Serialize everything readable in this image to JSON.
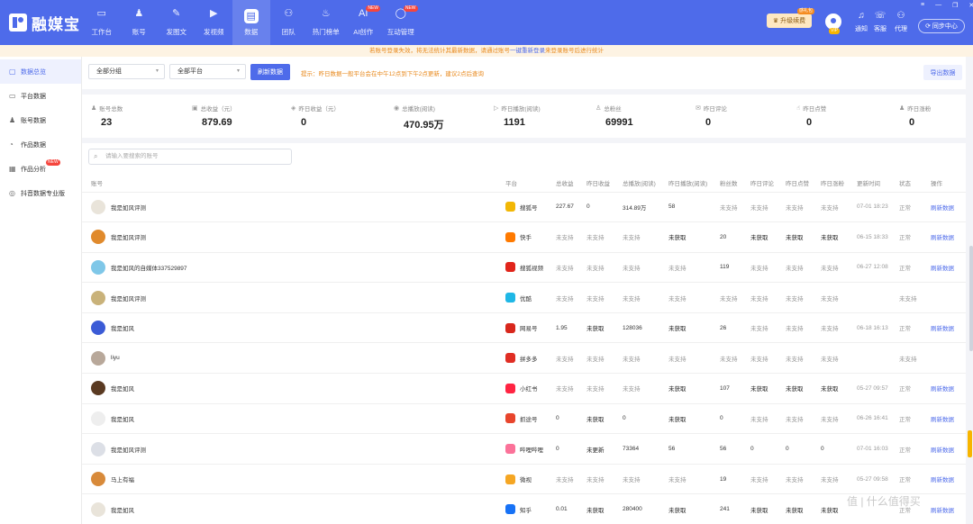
{
  "brand": {
    "name": "融媒宝"
  },
  "nav": [
    {
      "label": "工作台",
      "icon": "monitor-icon",
      "glyph": "▭"
    },
    {
      "label": "账号",
      "icon": "user-icon",
      "glyph": "♟"
    },
    {
      "label": "发图文",
      "icon": "pen-icon",
      "glyph": "✎"
    },
    {
      "label": "发视频",
      "icon": "video-icon",
      "glyph": "▶"
    },
    {
      "label": "数据",
      "icon": "data-icon",
      "glyph": "▤"
    },
    {
      "label": "团队",
      "icon": "team-icon",
      "glyph": "⚇"
    },
    {
      "label": "热门榜单",
      "icon": "fire-icon",
      "glyph": "♨"
    },
    {
      "label": "AI创作",
      "icon": "ai-icon",
      "glyph": "AI",
      "badge": "NEW"
    },
    {
      "label": "互动管理",
      "icon": "chat-icon",
      "glyph": "◯",
      "badge": "NEW"
    }
  ],
  "header": {
    "upgrade_label": "升级续费",
    "upgrade_tag": "感礼包",
    "vip_label": "VIP",
    "tools": [
      {
        "label": "通知",
        "icon": "bell-icon",
        "glyph": "♫"
      },
      {
        "label": "客服",
        "icon": "service-icon",
        "glyph": "☏"
      },
      {
        "label": "代理",
        "icon": "agent-icon",
        "glyph": "⚇"
      }
    ],
    "sync_label": "同步中心",
    "window": {
      "settings": "≡",
      "minimize": "—",
      "restore": "❐",
      "close": "✕"
    }
  },
  "notice": {
    "text_before": "若账号登录失效，将无法统计其最新数据，请通过账号",
    "link_text": "一键重新登录",
    "text_after": "来登录账号后进行统计"
  },
  "sidebar": [
    {
      "label": "数据总览",
      "icon": "overview-icon",
      "glyph": "▢",
      "active": true
    },
    {
      "label": "平台数据",
      "icon": "platform-icon",
      "glyph": "▭"
    },
    {
      "label": "账号数据",
      "icon": "account-icon",
      "glyph": "♟"
    },
    {
      "label": "作品数据",
      "icon": "works-icon",
      "glyph": "◔"
    },
    {
      "label": "作品分析",
      "icon": "analysis-icon",
      "glyph": "▦",
      "badge": "NEW"
    },
    {
      "label": "抖音数据专业版",
      "icon": "douyin-icon",
      "glyph": "◎"
    }
  ],
  "filters": {
    "group_select": "全部分组",
    "platform_select": "全部平台",
    "refresh_label": "刷新数据",
    "tip": "提示：昨日数据一般平台会在中午12点到下午2点更新，建议2点后查询",
    "export_label": "导出数据"
  },
  "stats": [
    {
      "label": "账号总数",
      "value": "23",
      "icon": "person-icon",
      "glyph": "♟"
    },
    {
      "label": "总收益（元）",
      "value": "879.69",
      "icon": "wallet-icon",
      "glyph": "▣"
    },
    {
      "label": "昨日收益（元）",
      "value": "0",
      "icon": "coin-icon",
      "glyph": "◈"
    },
    {
      "label": "总播放(阅读)",
      "value": "470.95万",
      "icon": "eye-icon",
      "glyph": "◉"
    },
    {
      "label": "昨日播放(阅读)",
      "value": "1191",
      "icon": "play-icon",
      "glyph": "▷"
    },
    {
      "label": "总粉丝",
      "value": "69991",
      "icon": "fans-icon",
      "glyph": "♙"
    },
    {
      "label": "昨日评论",
      "value": "0",
      "icon": "comment-icon",
      "glyph": "✉"
    },
    {
      "label": "昨日点赞",
      "value": "0",
      "icon": "like-icon",
      "glyph": "☝"
    },
    {
      "label": "昨日涨粉",
      "value": "0",
      "icon": "add-fan-icon",
      "glyph": "♟"
    }
  ],
  "search": {
    "placeholder": "请输入要搜索的账号"
  },
  "table": {
    "columns": [
      "账号",
      "平台",
      "总收益",
      "昨日收益",
      "总播放(阅读)",
      "昨日播放(阅读)",
      "粉丝数",
      "昨日评论",
      "昨日点赞",
      "昨日涨粉",
      "更新时间",
      "状态",
      "操作"
    ],
    "rows": [
      {
        "account": "我是如风评测",
        "avatar_color": "#e9e4da",
        "platform": "搜狐号",
        "platform_color": "#f2b705",
        "cells": [
          "227.67",
          "0",
          "314.89万",
          "58",
          "未支持",
          "未支持",
          "未支持",
          "未支持",
          "07-01 18:23",
          "正常",
          "刷新数据"
        ]
      },
      {
        "account": "我是如风评测",
        "avatar_color": "#e08a2c",
        "platform": "快手",
        "platform_color": "#ff7a00",
        "cells": [
          "未支持",
          "未支持",
          "未支持",
          "未获取",
          "20",
          "未获取",
          "未获取",
          "未获取",
          "06-15 18:33",
          "正常",
          "刷新数据"
        ]
      },
      {
        "account": "我是如风的自媒体337529897",
        "avatar_color": "#7fc7e8",
        "platform": "搜狐视频",
        "platform_color": "#e1251b",
        "cells": [
          "未支持",
          "未支持",
          "未支持",
          "未支持",
          "119",
          "未支持",
          "未支持",
          "未支持",
          "06-27 12:08",
          "正常",
          "刷新数据"
        ]
      },
      {
        "account": "我是如风评测",
        "avatar_color": "#c9b27a",
        "platform": "优酷",
        "platform_color": "#1fb7e6",
        "cells": [
          "未支持",
          "未支持",
          "未支持",
          "未支持",
          "未支持",
          "未支持",
          "未支持",
          "未支持",
          "",
          "未支持",
          ""
        ]
      },
      {
        "account": "我是如风",
        "avatar_color": "#3b5bd6",
        "platform": "网易号",
        "platform_color": "#d8271c",
        "cells": [
          "1.95",
          "未获取",
          "128036",
          "未获取",
          "26",
          "未支持",
          "未支持",
          "未支持",
          "06-18 16:13",
          "正常",
          "刷新数据"
        ]
      },
      {
        "account": "liyu",
        "avatar_color": "#b8a89a",
        "platform": "拼多多",
        "platform_color": "#e02e24",
        "cells": [
          "未支持",
          "未支持",
          "未支持",
          "未支持",
          "未支持",
          "未支持",
          "未支持",
          "未支持",
          "",
          "未支持",
          ""
        ]
      },
      {
        "account": "我是如风",
        "avatar_color": "#5a3a22",
        "platform": "小红书",
        "platform_color": "#ff2442",
        "cells": [
          "未支持",
          "未支持",
          "未支持",
          "未获取",
          "107",
          "未获取",
          "未获取",
          "未获取",
          "05-27 09:57",
          "正常",
          "刷新数据"
        ]
      },
      {
        "account": "我是如风",
        "avatar_color": "#eeeeee",
        "platform": "抓途号",
        "platform_color": "#e8452c",
        "cells": [
          "0",
          "未获取",
          "0",
          "未获取",
          "0",
          "未支持",
          "未支持",
          "未支持",
          "06-26 16:41",
          "正常",
          "刷新数据"
        ]
      },
      {
        "account": "我是如风评测",
        "avatar_color": "#dcdfe6",
        "platform": "哔哩哔哩",
        "platform_color": "#fb7299",
        "cells": [
          "0",
          "未更新",
          "73364",
          "56",
          "56",
          "0",
          "0",
          "0",
          "07-01 16:03",
          "正常",
          "刷新数据"
        ]
      },
      {
        "account": "马上有福",
        "avatar_color": "#d88a3a",
        "platform": "微视",
        "platform_color": "#f5a623",
        "cells": [
          "未支持",
          "未支持",
          "未支持",
          "未支持",
          "19",
          "未支持",
          "未支持",
          "未支持",
          "05-27 09:58",
          "正常",
          "刷新数据"
        ]
      },
      {
        "account": "我是如风",
        "avatar_color": "#e9e4da",
        "platform": "知乎",
        "platform_color": "#1772f6",
        "cells": [
          "0.01",
          "未获取",
          "280400",
          "未获取",
          "241",
          "未获取",
          "未获取",
          "未获取",
          "",
          "正常",
          "刷新数据"
        ]
      }
    ]
  },
  "watermark": "值 | 什么值得买"
}
